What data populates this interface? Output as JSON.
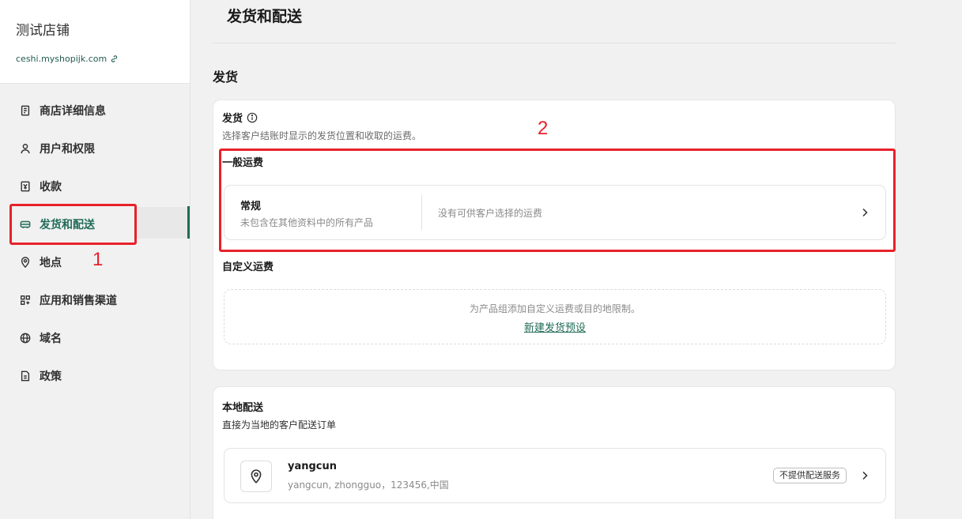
{
  "store": {
    "name": "测试店铺",
    "url": "ceshi.myshopijk.com"
  },
  "nav": {
    "items": [
      {
        "label": "商店详细信息",
        "icon": "store-doc-icon"
      },
      {
        "label": "用户和权限",
        "icon": "user-icon"
      },
      {
        "label": "收款",
        "icon": "payment-icon"
      },
      {
        "label": "发货和配送",
        "icon": "truck-icon",
        "active": true
      },
      {
        "label": "地点",
        "icon": "location-pin-icon"
      },
      {
        "label": "应用和销售渠道",
        "icon": "apps-grid-icon"
      },
      {
        "label": "域名",
        "icon": "globe-icon"
      },
      {
        "label": "政策",
        "icon": "policy-doc-icon"
      }
    ]
  },
  "annotations": {
    "label_1": "1",
    "label_2": "2",
    "color": "#e8212a"
  },
  "page": {
    "title": "发货和配送",
    "section_title": "发货"
  },
  "shipping_card": {
    "heading": "发货",
    "subtitle": "选择客户结账时显示的发货位置和收取的运费。",
    "general_rates_label": "一般运费",
    "rate": {
      "name": "常规",
      "desc": "未包含在其他资料中的所有产品",
      "note": "没有可供客户选择的运费"
    },
    "custom_rates_label": "自定义运费",
    "custom_empty_text": "为产品组添加自定义运费或目的地限制。",
    "custom_empty_link": "新建发货预设"
  },
  "local_card": {
    "heading": "本地配送",
    "subtitle": "直接为当地的客户配送订单",
    "location": {
      "name": "yangcun",
      "address": "yangcun, zhongguo，123456,中国",
      "badge": "不提供配送服务"
    }
  },
  "colors": {
    "accent": "#1f6b56",
    "annotation": "#e8212a"
  }
}
